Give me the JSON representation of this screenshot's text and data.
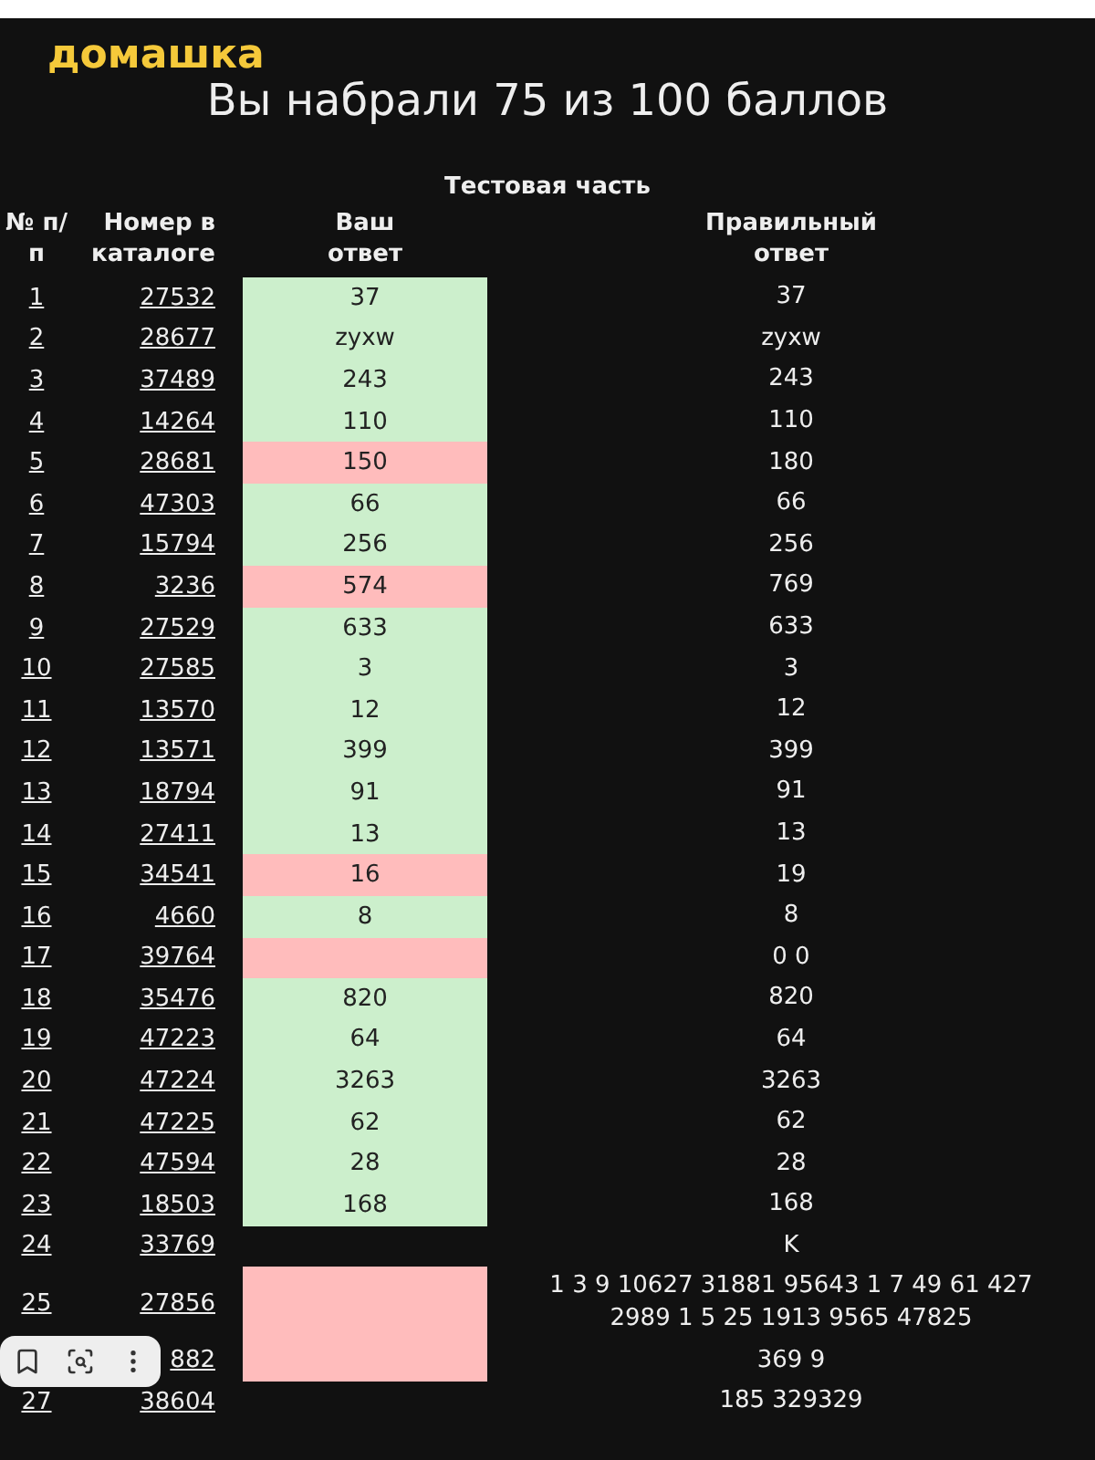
{
  "logo": "домашка",
  "title": "Вы набрали 75 из 100 баллов",
  "section": "Тестовая часть",
  "columns": [
    "№ п/п",
    "Номер в каталоге",
    "Ваш ответ",
    "Правильный ответ"
  ],
  "rows": [
    {
      "no": "1",
      "catalog": "27532",
      "answer": "37",
      "is_correct": true,
      "correct": "37"
    },
    {
      "no": "2",
      "catalog": "28677",
      "answer": "zyxw",
      "is_correct": true,
      "correct": "zyxw"
    },
    {
      "no": "3",
      "catalog": "37489",
      "answer": "243",
      "is_correct": true,
      "correct": "243"
    },
    {
      "no": "4",
      "catalog": "14264",
      "answer": "110",
      "is_correct": true,
      "correct": "110"
    },
    {
      "no": "5",
      "catalog": "28681",
      "answer": "150",
      "is_correct": false,
      "correct": "180"
    },
    {
      "no": "6",
      "catalog": "47303",
      "answer": "66",
      "is_correct": true,
      "correct": "66"
    },
    {
      "no": "7",
      "catalog": "15794",
      "answer": "256",
      "is_correct": true,
      "correct": "256"
    },
    {
      "no": "8",
      "catalog": "3236",
      "answer": "574",
      "is_correct": false,
      "correct": "769"
    },
    {
      "no": "9",
      "catalog": "27529",
      "answer": "633",
      "is_correct": true,
      "correct": "633"
    },
    {
      "no": "10",
      "catalog": "27585",
      "answer": "3",
      "is_correct": true,
      "correct": "3"
    },
    {
      "no": "11",
      "catalog": "13570",
      "answer": "12",
      "is_correct": true,
      "correct": "12"
    },
    {
      "no": "12",
      "catalog": "13571",
      "answer": "399",
      "is_correct": true,
      "correct": "399"
    },
    {
      "no": "13",
      "catalog": "18794",
      "answer": "91",
      "is_correct": true,
      "correct": "91"
    },
    {
      "no": "14",
      "catalog": "27411",
      "answer": "13",
      "is_correct": true,
      "correct": "13"
    },
    {
      "no": "15",
      "catalog": "34541",
      "answer": "16",
      "is_correct": false,
      "correct": "19"
    },
    {
      "no": "16",
      "catalog": "4660",
      "answer": "8",
      "is_correct": true,
      "correct": "8"
    },
    {
      "no": "17",
      "catalog": "39764",
      "is_correct": false,
      "correct": "0 0"
    },
    {
      "no": "18",
      "catalog": "35476",
      "answer": "820",
      "is_correct": true,
      "correct": "820"
    },
    {
      "no": "19",
      "catalog": "47223",
      "answer": "64",
      "is_correct": true,
      "correct": "64"
    },
    {
      "no": "20",
      "catalog": "47224",
      "answer": "3263",
      "is_correct": true,
      "correct": "3263"
    },
    {
      "no": "21",
      "catalog": "47225",
      "answer": "62",
      "is_correct": true,
      "correct": "62"
    },
    {
      "no": "22",
      "catalog": "47594",
      "answer": "28",
      "is_correct": true,
      "correct": "28"
    },
    {
      "no": "23",
      "catalog": "18503",
      "answer": "168",
      "is_correct": true,
      "correct": "168"
    },
    {
      "no": "24",
      "catalog": "33769",
      "correct": "K"
    },
    {
      "no": "25",
      "catalog": "27856",
      "is_correct": false,
      "correct": "1 3 9 10627 31881 95643 1 7 49 61 427 2989 1 5 25 1913 9565 47825"
    },
    {
      "catalog": "882",
      "is_correct": false,
      "correct": "369 9"
    },
    {
      "no": "27",
      "catalog": "38604",
      "correct": "185 329329"
    }
  ]
}
